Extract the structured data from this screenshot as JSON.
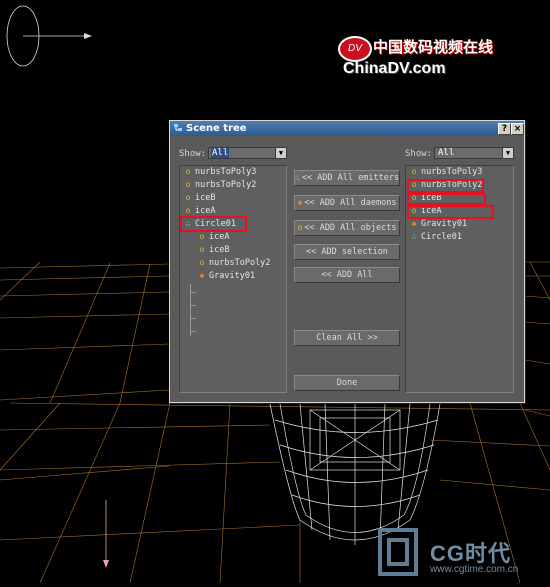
{
  "watermark": {
    "badge": "DV",
    "cn_text": "中国数码视频在线",
    "en_text": "ChinaDV.com",
    "cg_text": "CG时代",
    "cg_url": "www.cgtime.com.cn"
  },
  "dialog": {
    "title": "Scene tree",
    "help_label": "?",
    "close_label": "×",
    "left_show_label": "Show:",
    "left_show_value": "All",
    "right_show_label": "Show:",
    "right_show_value": "All",
    "left_tree": [
      {
        "icon": "ring",
        "label": "nurbsToPoly3"
      },
      {
        "icon": "ring",
        "label": "nurbsToPoly2"
      },
      {
        "icon": "ring",
        "label": "iceB"
      },
      {
        "icon": "ring",
        "label": "iceA"
      },
      {
        "icon": "dots",
        "label": "Circle01"
      },
      {
        "icon": "ring",
        "label": "iceA"
      },
      {
        "icon": "ring",
        "label": "iceB"
      },
      {
        "icon": "ring",
        "label": "nurbsToPoly2"
      },
      {
        "icon": "cross",
        "label": "Gravity01"
      }
    ],
    "right_tree": [
      {
        "icon": "ring",
        "label": "nurbsToPoly3"
      },
      {
        "icon": "ring",
        "label": "nurbsToPoly2"
      },
      {
        "icon": "ring",
        "label": "iceB"
      },
      {
        "icon": "ring",
        "label": "iceA"
      },
      {
        "icon": "cross",
        "label": "Gravity01"
      },
      {
        "icon": "dots",
        "label": "Circle01"
      }
    ],
    "buttons": {
      "add_emitters": "<< ADD All emitters",
      "add_daemons": "<< ADD All daemons",
      "add_objects": "<< ADD All objects",
      "add_selection": "<< ADD selection",
      "add_all": "<< ADD All",
      "clean_all": "Clean All >>",
      "done": "Done"
    }
  }
}
